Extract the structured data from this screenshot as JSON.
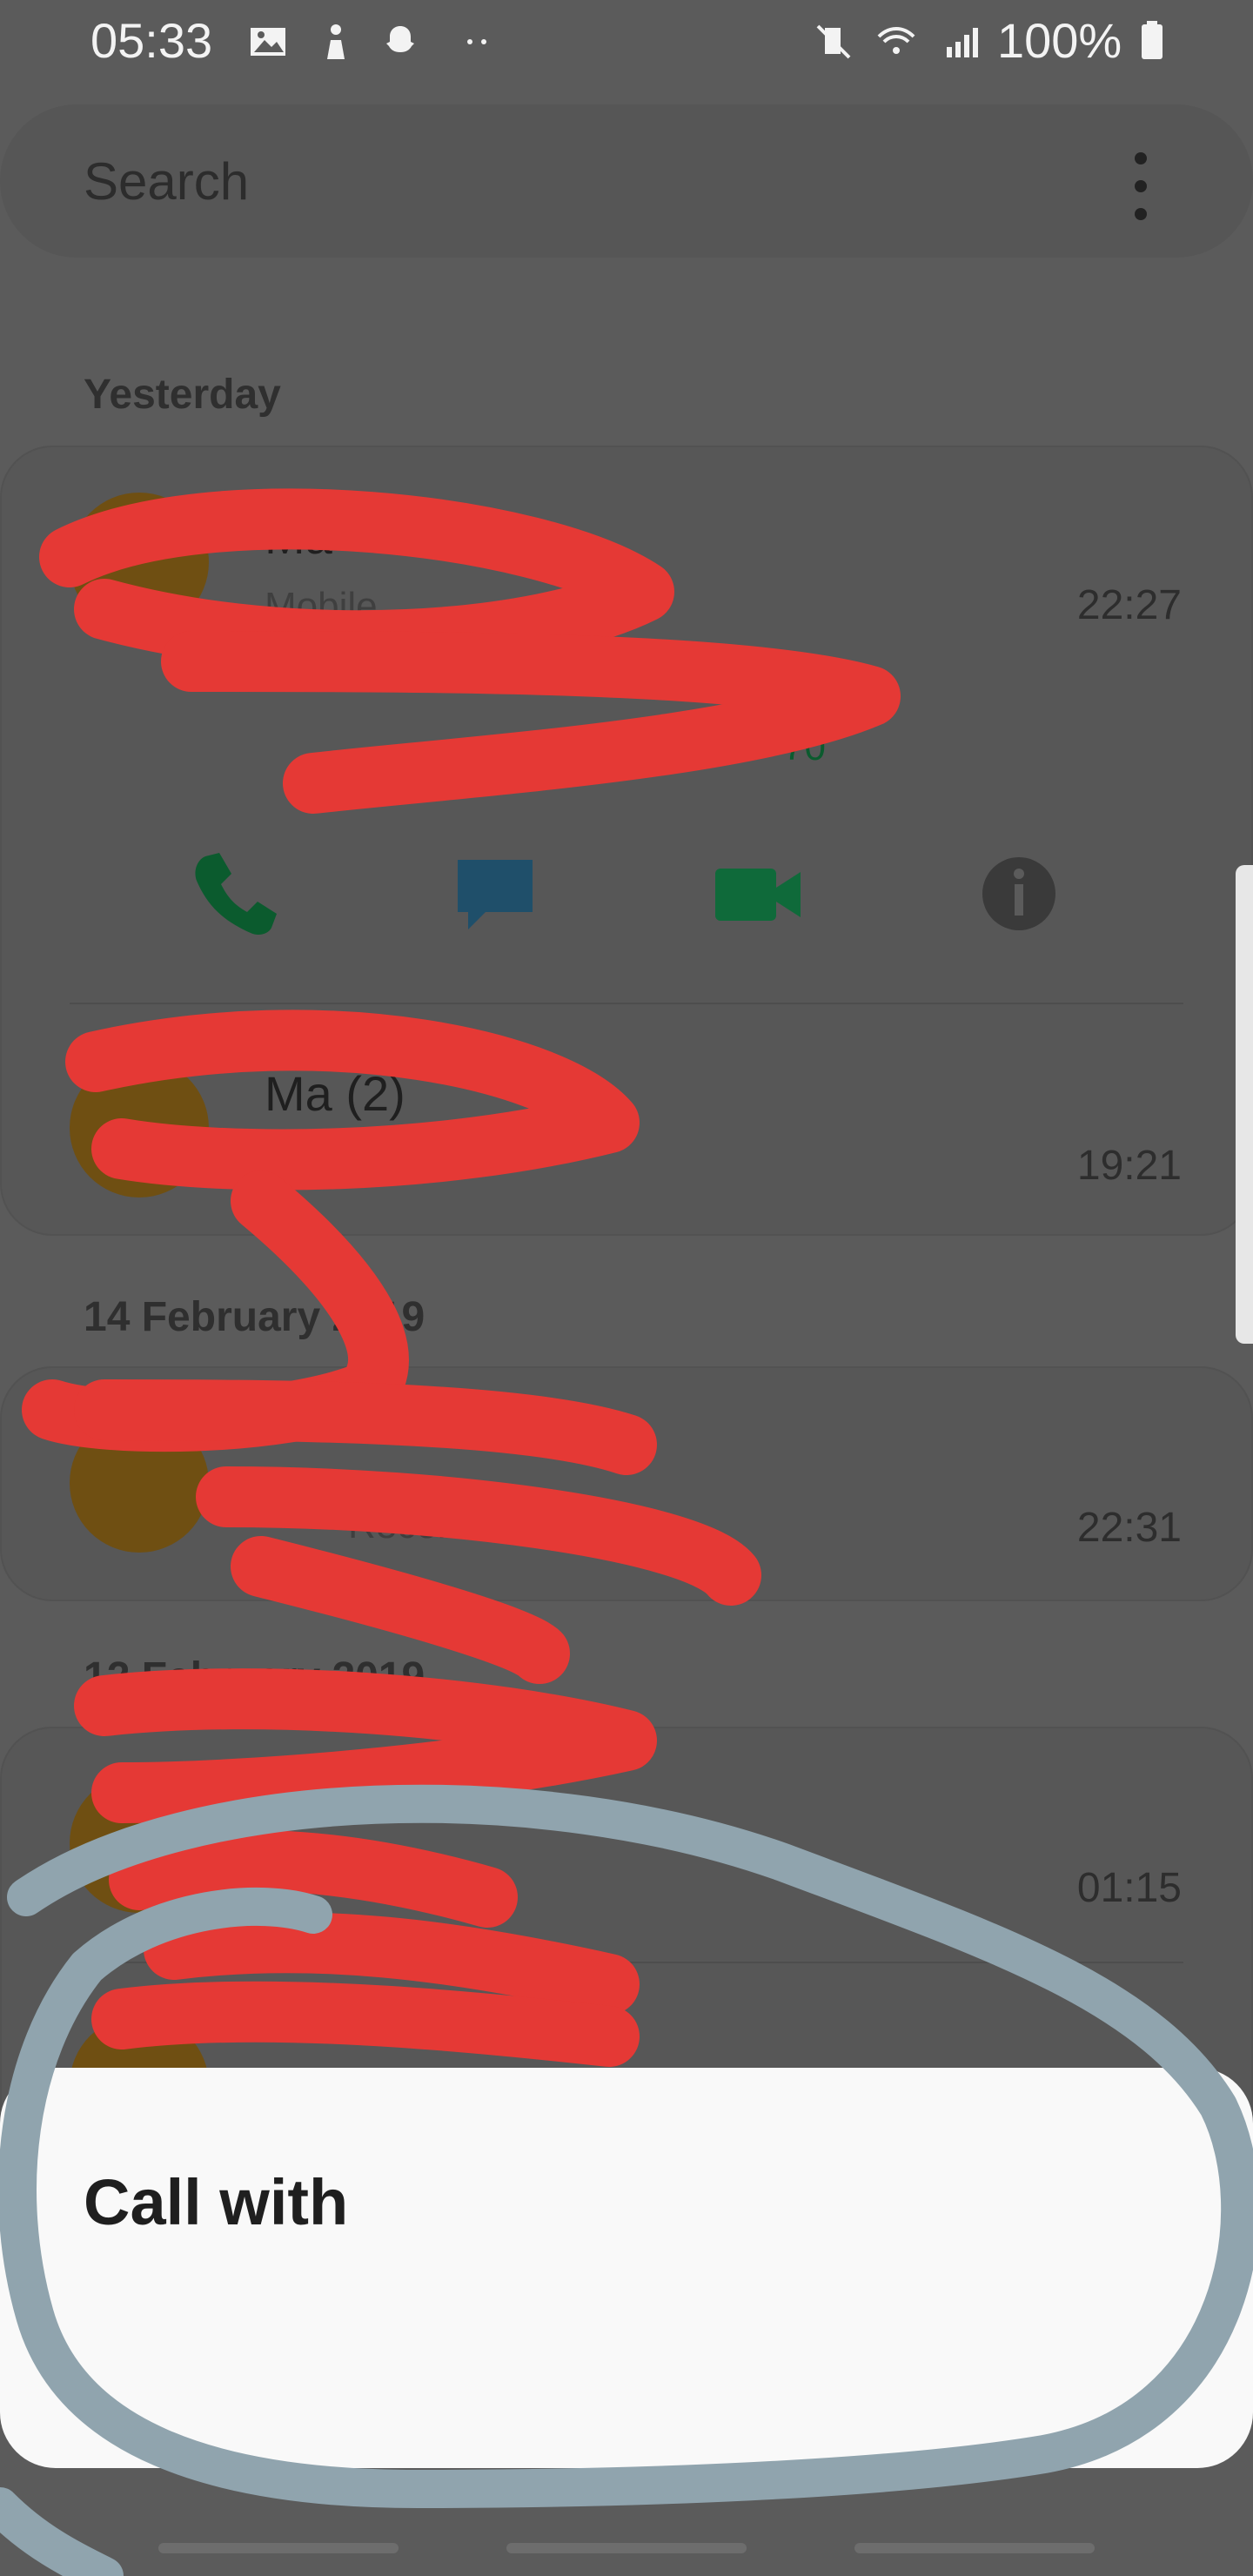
{
  "status_bar": {
    "time": "05:33",
    "battery": "100%",
    "icons": [
      "image-icon",
      "person-icon",
      "snapchat-icon",
      "more-icon",
      "mute-icon",
      "wifi-icon",
      "signal-icon",
      "battery-icon"
    ]
  },
  "search": {
    "placeholder": "Search",
    "menu_icon": "kebab-icon"
  },
  "sections": {
    "yesterday": "Yesterday",
    "feb14": "14 February 2019",
    "feb12": "12 February 2019"
  },
  "calls": [
    {
      "name": "Ma",
      "sub": "Mobile",
      "time": "22:27",
      "number_tail": "70"
    },
    {
      "name": "Ma (2)",
      "sub": "",
      "time": "19:21"
    },
    {
      "name": "",
      "sub": "Received",
      "time": "22:31"
    },
    {
      "name": "",
      "sub": "",
      "time": "01:15"
    }
  ],
  "actions": [
    "phone-icon",
    "message-icon",
    "video-call-icon",
    "info-icon"
  ],
  "sheet": {
    "title": "Call with"
  },
  "colors": {
    "phone": "#0b5b2e",
    "message": "#1f4f6a",
    "video": "#0f6a3a",
    "info": "#3a3a3a",
    "scribble_red": "#e53935",
    "scribble_blue": "#90a4ae"
  }
}
